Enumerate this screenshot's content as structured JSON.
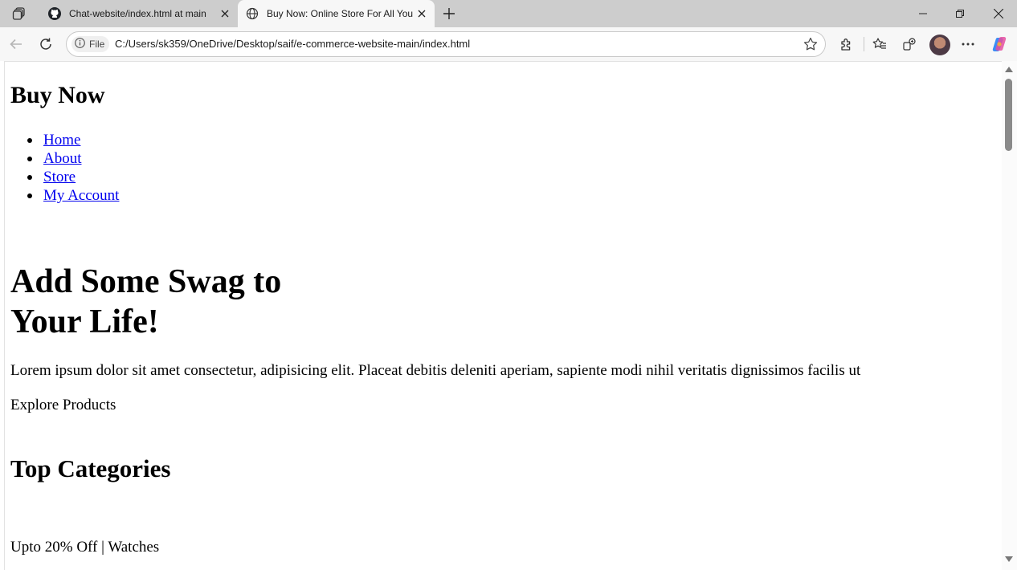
{
  "tabs": [
    {
      "title": "Chat-website/index.html at main",
      "icon": "github-icon",
      "active": false
    },
    {
      "title": "Buy Now: Online Store For All You",
      "icon": "globe-icon",
      "active": true
    }
  ],
  "address_bar": {
    "scheme_label": "File",
    "url": "C:/Users/sk359/OneDrive/Desktop/saif/e-commerce-website-main/index.html"
  },
  "page": {
    "brand": "Buy Now",
    "nav": [
      "Home",
      "About",
      "Store",
      "My Account"
    ],
    "hero_title": "Add Some Swag to Your Life!",
    "hero_text": "Lorem ipsum dolor sit amet consectetur, adipisicing elit. Placeat debitis deleniti aperiam, sapiente modi nihil veritatis dignissimos facilis ut",
    "explore_label": "Explore Products",
    "categories_heading": "Top Categories",
    "category_1": "Upto 20% Off | Watches"
  },
  "colors": {
    "tabstrip_bg": "#cdcdcd",
    "toolbar_bg": "#f7f7f7",
    "link": "#0000ee"
  }
}
